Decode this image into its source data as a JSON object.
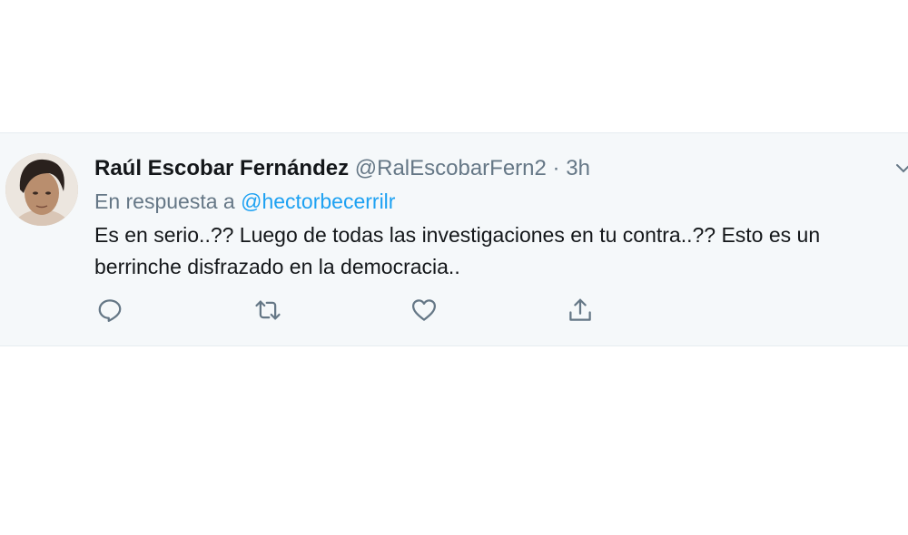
{
  "tweet": {
    "author_name": "Raúl Escobar Fernández",
    "author_handle": "@RalEscobarFern2",
    "separator": "·",
    "time": "3h",
    "reply_prefix": "En respuesta a",
    "reply_to": "@hectorbecerrilr",
    "text": "Es en serio..?? Luego de todas las investigaciones en tu contra..?? Esto es un berrinche disfrazado en la democracia.."
  },
  "actions": {
    "reply_icon": "reply-icon",
    "retweet_icon": "retweet-icon",
    "like_icon": "like-icon",
    "share_icon": "share-icon"
  },
  "colors": {
    "background": "#f5f8fa",
    "text": "#14171a",
    "secondary": "#657786",
    "link": "#1da1f2"
  }
}
